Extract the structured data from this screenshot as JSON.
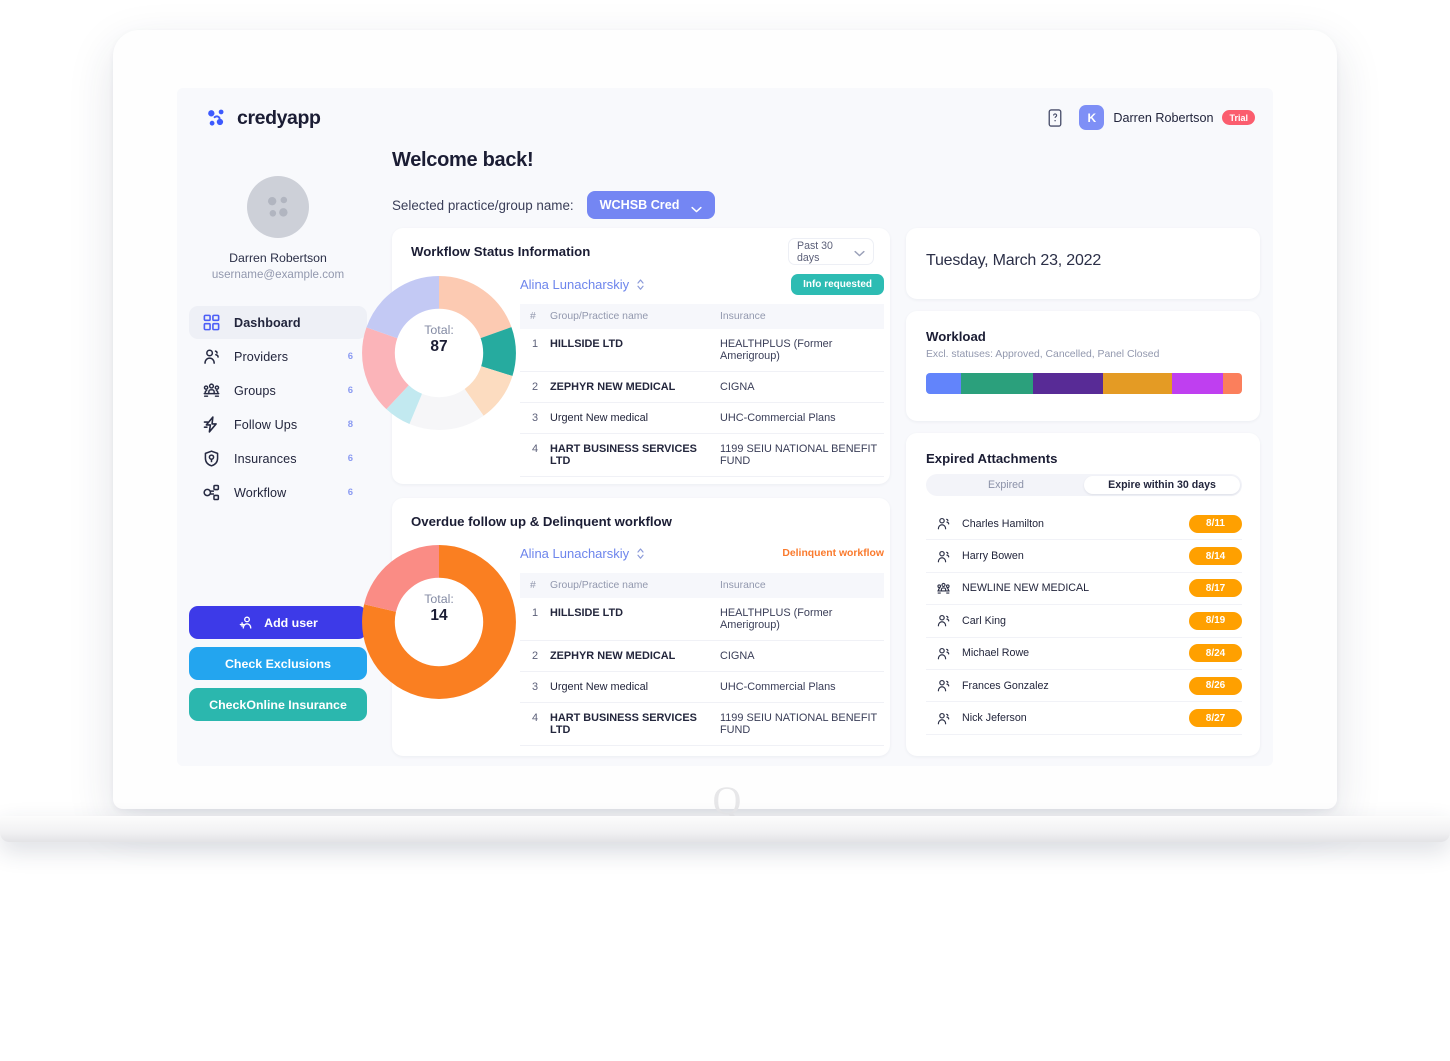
{
  "brand": {
    "name": "credyapp",
    "mark_icon": "credyapp-logo-icon"
  },
  "topbar": {
    "help_icon": "help-book-icon",
    "avatar_initial": "K",
    "user_name": "Darren Robertson",
    "trial_label": "Trial"
  },
  "sidebar": {
    "profile": {
      "avatar_icon": "user-avatar-placeholder-icon",
      "name": "Darren Robertson",
      "email": "username@example.com"
    },
    "items": [
      {
        "label": "Dashboard",
        "icon": "grid-dashboard-icon",
        "badge": "",
        "active": true
      },
      {
        "label": "Providers",
        "icon": "provider-person-icon",
        "badge": "6",
        "active": false
      },
      {
        "label": "Groups",
        "icon": "groups-people-icon",
        "badge": "6",
        "active": false
      },
      {
        "label": "Follow Ups",
        "icon": "lightning-bolt-icon",
        "badge": "8",
        "active": false
      },
      {
        "label": "Insurances",
        "icon": "shield-check-icon",
        "badge": "6",
        "active": false
      },
      {
        "label": "Workflow",
        "icon": "workflow-nodes-icon",
        "badge": "6",
        "active": false
      }
    ],
    "actions": [
      {
        "label": "Add user",
        "icon": "add-user-icon",
        "color": "#3d3ae8"
      },
      {
        "label": "Check Exclusions",
        "icon": "",
        "color": "#23a5ef"
      },
      {
        "label": "CheckOnline Insurance",
        "icon": "",
        "color": "#2bb7ae"
      }
    ]
  },
  "main": {
    "welcome_title": "Welcome back!",
    "practice_label": "Selected practice/group name:",
    "practice_value": "WCHSB Cred",
    "chevron_icon": "chevron-down-icon"
  },
  "workflow_card": {
    "title": "Workflow Status Information",
    "range_value": "Past 30 days",
    "owner_name": "Alina Lunacharskiy",
    "sort_icon": "sort-updown-icon",
    "status_pill": "Info requested",
    "total_label": "Total:",
    "total_value": "87",
    "columns": [
      "#",
      "Group/Practice name",
      "Insurance"
    ],
    "rows": [
      {
        "num": "1",
        "name": "HILLSIDE LTD",
        "bold": true,
        "insurance": "HEALTHPLUS (Former Amerigroup)"
      },
      {
        "num": "2",
        "name": "ZEPHYR NEW MEDICAL",
        "bold": true,
        "insurance": "CIGNA"
      },
      {
        "num": "3",
        "name": "Urgent New medical",
        "bold": false,
        "insurance": "UHC-Commercial Plans"
      },
      {
        "num": "4",
        "name": "HART BUSINESS SERVICES LTD",
        "bold": true,
        "insurance": "1199 SEIU NATIONAL BENEFIT FUND"
      }
    ]
  },
  "overdue_card": {
    "title": "Overdue follow up & Delinquent workflow",
    "owner_name": "Alina Lunacharskiy",
    "sort_icon": "sort-updown-icon",
    "status_pill": "Delinquent workflow",
    "total_label": "Total:",
    "total_value": "14",
    "columns": [
      "#",
      "Group/Practice name",
      "Insurance"
    ],
    "rows": [
      {
        "num": "1",
        "name": "HILLSIDE LTD",
        "bold": true,
        "insurance": "HEALTHPLUS (Former Amerigroup)"
      },
      {
        "num": "2",
        "name": "ZEPHYR NEW MEDICAL",
        "bold": true,
        "insurance": "CIGNA"
      },
      {
        "num": "3",
        "name": "Urgent New medical",
        "bold": false,
        "insurance": "UHC-Commercial Plans"
      },
      {
        "num": "4",
        "name": "HART BUSINESS SERVICES LTD",
        "bold": true,
        "insurance": "1199 SEIU NATIONAL BENEFIT FUND"
      }
    ]
  },
  "date_card": {
    "date_text": "Tuesday, March 23, 2022"
  },
  "workload_card": {
    "title": "Workload",
    "subtitle": "Excl. statuses: Approved, Cancelled, Panel Closed",
    "segments": [
      {
        "color": "#6284fb",
        "weight": 11
      },
      {
        "color": "#2ba07c",
        "weight": 23
      },
      {
        "color": "#582b96",
        "weight": 22
      },
      {
        "color": "#e49b24",
        "weight": 22
      },
      {
        "color": "#bf3ff0",
        "weight": 16
      },
      {
        "color": "#fb7f5c",
        "weight": 6
      }
    ]
  },
  "expired_card": {
    "title": "Expired Attachments",
    "tabs": [
      {
        "label": "Expired",
        "selected": false
      },
      {
        "label": "Expire within 30 days",
        "selected": true
      }
    ],
    "badge_color": "#ffa000",
    "rows": [
      {
        "icon": "provider-person-icon",
        "name": "Charles Hamilton",
        "date": "8/11"
      },
      {
        "icon": "provider-person-icon",
        "name": "Harry Bowen",
        "date": "8/14"
      },
      {
        "icon": "groups-people-icon",
        "name": "NEWLINE NEW MEDICAL",
        "date": "8/17"
      },
      {
        "icon": "provider-person-icon",
        "name": "Carl King",
        "date": "8/19"
      },
      {
        "icon": "provider-person-icon",
        "name": "Michael Rowe",
        "date": "8/24"
      },
      {
        "icon": "provider-person-icon",
        "name": "Frances Gonzalez",
        "date": "8/26"
      },
      {
        "icon": "provider-person-icon",
        "name": "Nick Jeferson",
        "date": "8/27"
      }
    ]
  },
  "chart_data": [
    {
      "type": "pie",
      "title": "Workflow Status Information",
      "total_label": "Total:",
      "total": 87,
      "legend": "none",
      "categories": [
        "Peach",
        "Teal",
        "Light peach",
        "Off white",
        "Light cyan",
        "Pink",
        "Periwinkle"
      ],
      "values": [
        17,
        9,
        9,
        14,
        5,
        16,
        17
      ],
      "colors": [
        "#fccab2",
        "#26ab9f",
        "#fcdcc0",
        "#f6f6f8",
        "#c2e9f0",
        "#fbb4b9",
        "#c3c9f4"
      ]
    },
    {
      "type": "pie",
      "title": "Overdue follow up & Delinquent workflow",
      "total_label": "Total:",
      "total": 14,
      "legend": "none",
      "categories": [
        "Overdue",
        "Delinquent"
      ],
      "values": [
        11,
        3
      ],
      "colors": [
        "#fa7f21",
        "#fa8c85"
      ]
    },
    {
      "type": "bar",
      "title": "Workload",
      "subtitle": "Excl. statuses: Approved, Cancelled, Panel Closed",
      "orientation": "stacked-horizontal",
      "categories": [
        "s1",
        "s2",
        "s3",
        "s4",
        "s5",
        "s6"
      ],
      "values": [
        11,
        23,
        22,
        22,
        16,
        6
      ],
      "colors": [
        "#6284fb",
        "#2ba07c",
        "#582b96",
        "#e49b24",
        "#bf3ff0",
        "#fb7f5c"
      ]
    }
  ]
}
